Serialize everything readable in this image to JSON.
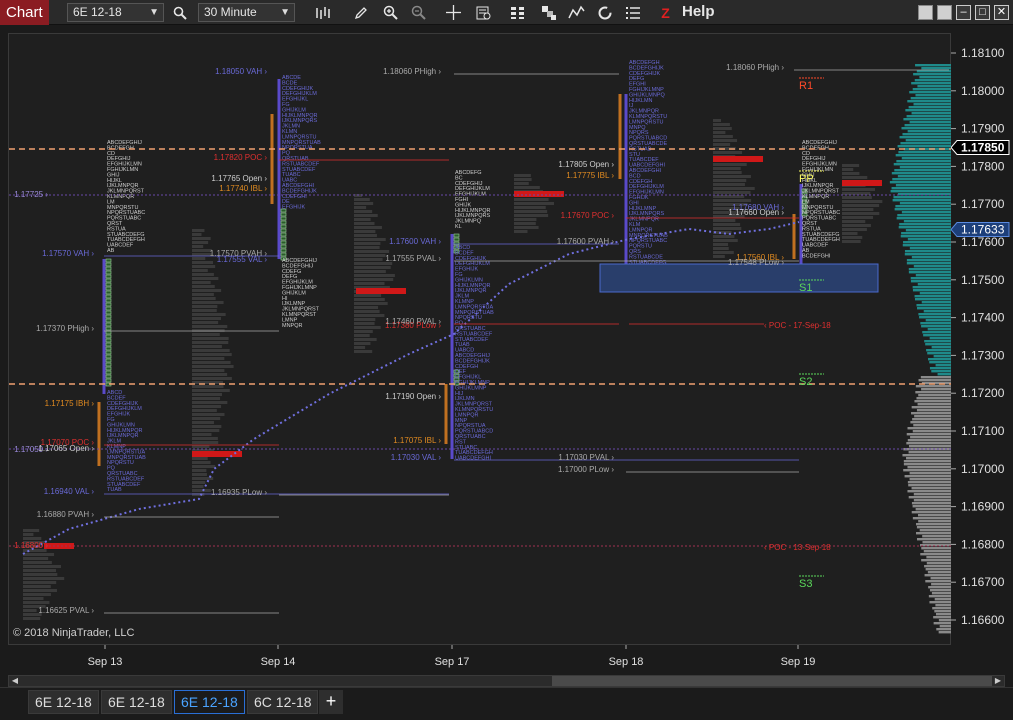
{
  "toolbar": {
    "app_title": "Chart",
    "instrument": "6E 12-18",
    "interval": "30 Minute",
    "help_label": "Help"
  },
  "icons": [
    "search-icon",
    "bar-style-icon",
    "pencil-icon",
    "zoom-in-icon",
    "zoom-out-icon",
    "crosshair-icon",
    "data-box-icon",
    "chart-trader-icon",
    "strategies-icon",
    "indicators-icon",
    "refresh-icon",
    "properties-icon",
    "zorder-icon"
  ],
  "window_buttons": [
    "minimize",
    "maximize",
    "restore",
    "close"
  ],
  "price_axis": {
    "ticks": [
      "1.18100",
      "1.18000",
      "1.17900",
      "1.17800",
      "1.17700",
      "1.17600",
      "1.17500",
      "1.17400",
      "1.17300",
      "1.17200",
      "1.17100",
      "1.17000",
      "1.16900",
      "1.16800",
      "1.16700",
      "1.16600"
    ],
    "marker_white": "1.17850",
    "marker_blue": "1.17633"
  },
  "time_axis": [
    "Sep 13",
    "Sep 14",
    "Sep 17",
    "Sep 18",
    "Sep 19"
  ],
  "labels": {
    "sep13": [
      "1.17725",
      "1.17570 VAH",
      "1.17370 PHigh",
      "1.17175 IBH",
      "1.17070 POC",
      "1.17050",
      "1.17065 Open",
      "1.16940 VAL",
      "1.16880 PVAH",
      "1.16800",
      "1.16625 PVAL"
    ],
    "sep14": [
      "1.18050 VAH",
      "1.17820 POC",
      "1.17765 Open",
      "1.17740 IBL",
      "1.17570 PVAH",
      "1.17555 VAL",
      "1.16935 PLow"
    ],
    "sep17": [
      "1.18060 PHigh",
      "1.17600 VAH",
      "1.17555 PVAL",
      "1.17190 Open",
      "1.17075 IBL",
      "1.17030 VAL"
    ],
    "sep18": [
      "1.17805 Open",
      "1.17775 IBL",
      "1.17670 POC",
      "1.17600 PVAH",
      "1.17030 PVAL",
      "1.17000 PLow",
      "1.17380 PLow",
      "1.17460 PVAL"
    ],
    "sep19": [
      "1.18060 PHigh",
      "1.17680 VAH",
      "1.17660 Open",
      "1.17560 IBL",
      "1.17548 PLow",
      "POC - 17-Sep-18",
      "POC - 13-Sep-18"
    ],
    "pivots": [
      "R1",
      "PP",
      "S1",
      "S2",
      "S3"
    ]
  },
  "copyright": "© 2018 NinjaTrader, LLC",
  "tabs": [
    {
      "label": "6E 12-18",
      "active": false
    },
    {
      "label": "6E 12-18",
      "active": false
    },
    {
      "label": "6E 12-18",
      "active": true
    },
    {
      "label": "6C 12-18",
      "active": false
    }
  ],
  "colors": {
    "accent_red": "#8b1c22",
    "vwap": "#6a6ad8",
    "profile_teal": "#1d8f8f",
    "poc": "#d01818",
    "pivot_r": "#ff4a2a",
    "pivot_pp": "#ffff66",
    "pivot_s": "#5bd85b"
  }
}
